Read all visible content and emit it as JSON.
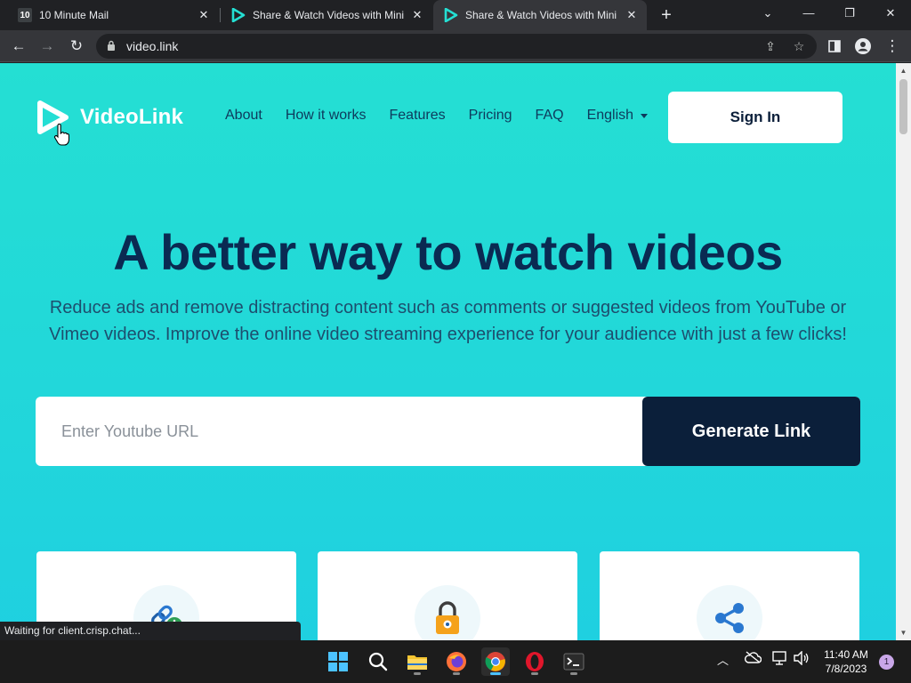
{
  "browser": {
    "tabs": [
      {
        "title": "10 Minute Mail",
        "favicon": "ten-minute-mail-icon",
        "active": false
      },
      {
        "title": "Share & Watch Videos with Mini",
        "favicon": "videolink-icon",
        "active": false
      },
      {
        "title": "Share & Watch Videos with Mini",
        "favicon": "videolink-icon",
        "active": true
      }
    ],
    "new_tab_symbol": "+",
    "address": "video.link",
    "status_text": "Waiting for client.crisp.chat..."
  },
  "site": {
    "brand": "VideoLink",
    "nav": [
      "About",
      "How it works",
      "Features",
      "Pricing",
      "FAQ"
    ],
    "language": "English",
    "signin_label": "Sign In",
    "hero_title": "A better way to watch videos",
    "hero_subtitle": "Reduce ads and remove distracting content such as comments or suggested videos from YouTube or Vimeo videos. Improve the online video streaming experience for your audience with just a few clicks!",
    "url_placeholder": "Enter Youtube URL",
    "generate_label": "Generate Link",
    "feature_cards": [
      {
        "icon": "link-add-icon"
      },
      {
        "icon": "padlock-icon"
      },
      {
        "icon": "share-icon"
      }
    ]
  },
  "taskbar": {
    "apps": [
      "start-icon",
      "search-icon",
      "file-explorer-icon",
      "firefox-icon",
      "chrome-icon",
      "opera-icon",
      "terminal-icon"
    ],
    "time": "11:40 AM",
    "date": "7/8/2023",
    "notification_count": "1"
  },
  "colors": {
    "page_gradient_top": "#24dfd3",
    "page_gradient_bottom": "#1fd0e0",
    "title_navy": "#0a2a52",
    "button_navy": "#0b1f3a"
  }
}
